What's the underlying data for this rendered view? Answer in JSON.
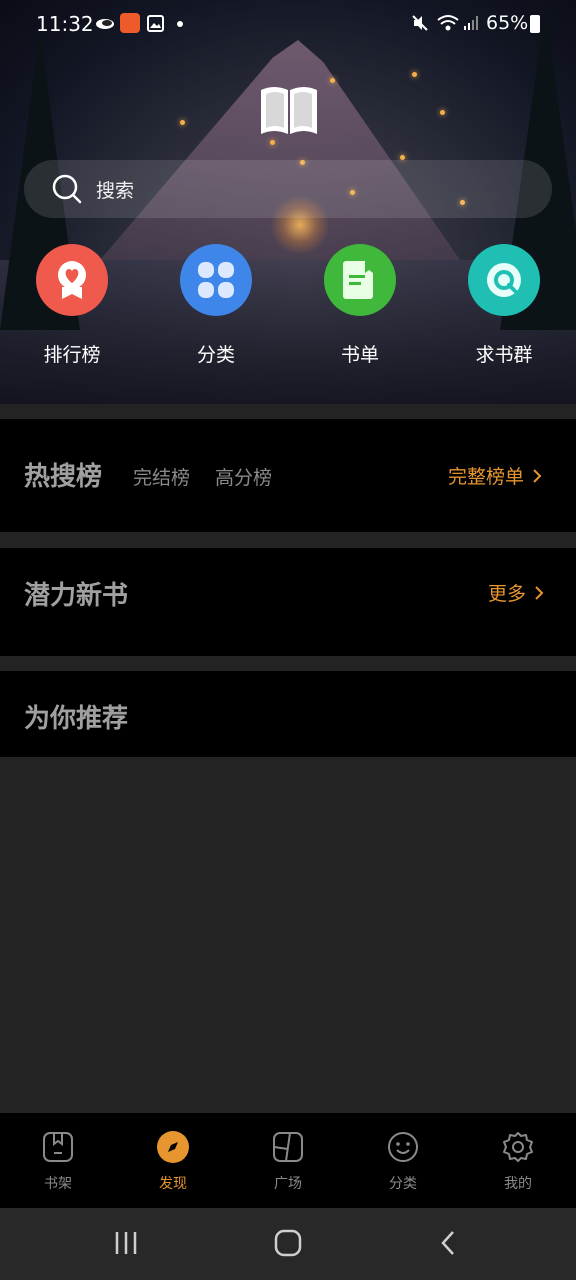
{
  "status_bar": {
    "time": "11:32",
    "battery": "65%"
  },
  "search": {
    "placeholder": "搜索"
  },
  "quick_entries": [
    {
      "label": "排行榜",
      "color": "#ef5a4d"
    },
    {
      "label": "分类",
      "color": "#3f86ea"
    },
    {
      "label": "书单",
      "color": "#3fb83c"
    },
    {
      "label": "求书群",
      "color": "#1fbfb4"
    }
  ],
  "rankings": {
    "title": "热搜榜",
    "tabs": [
      "完结榜",
      "高分榜"
    ],
    "more": "完整榜单"
  },
  "potential": {
    "title": "潜力新书",
    "more": "更多"
  },
  "recommend": {
    "title": "为你推荐"
  },
  "bottom_nav": [
    {
      "label": "书架"
    },
    {
      "label": "发现",
      "active": true
    },
    {
      "label": "广场"
    },
    {
      "label": "分类"
    },
    {
      "label": "我的"
    }
  ],
  "colors": {
    "accent": "#e6952f"
  }
}
